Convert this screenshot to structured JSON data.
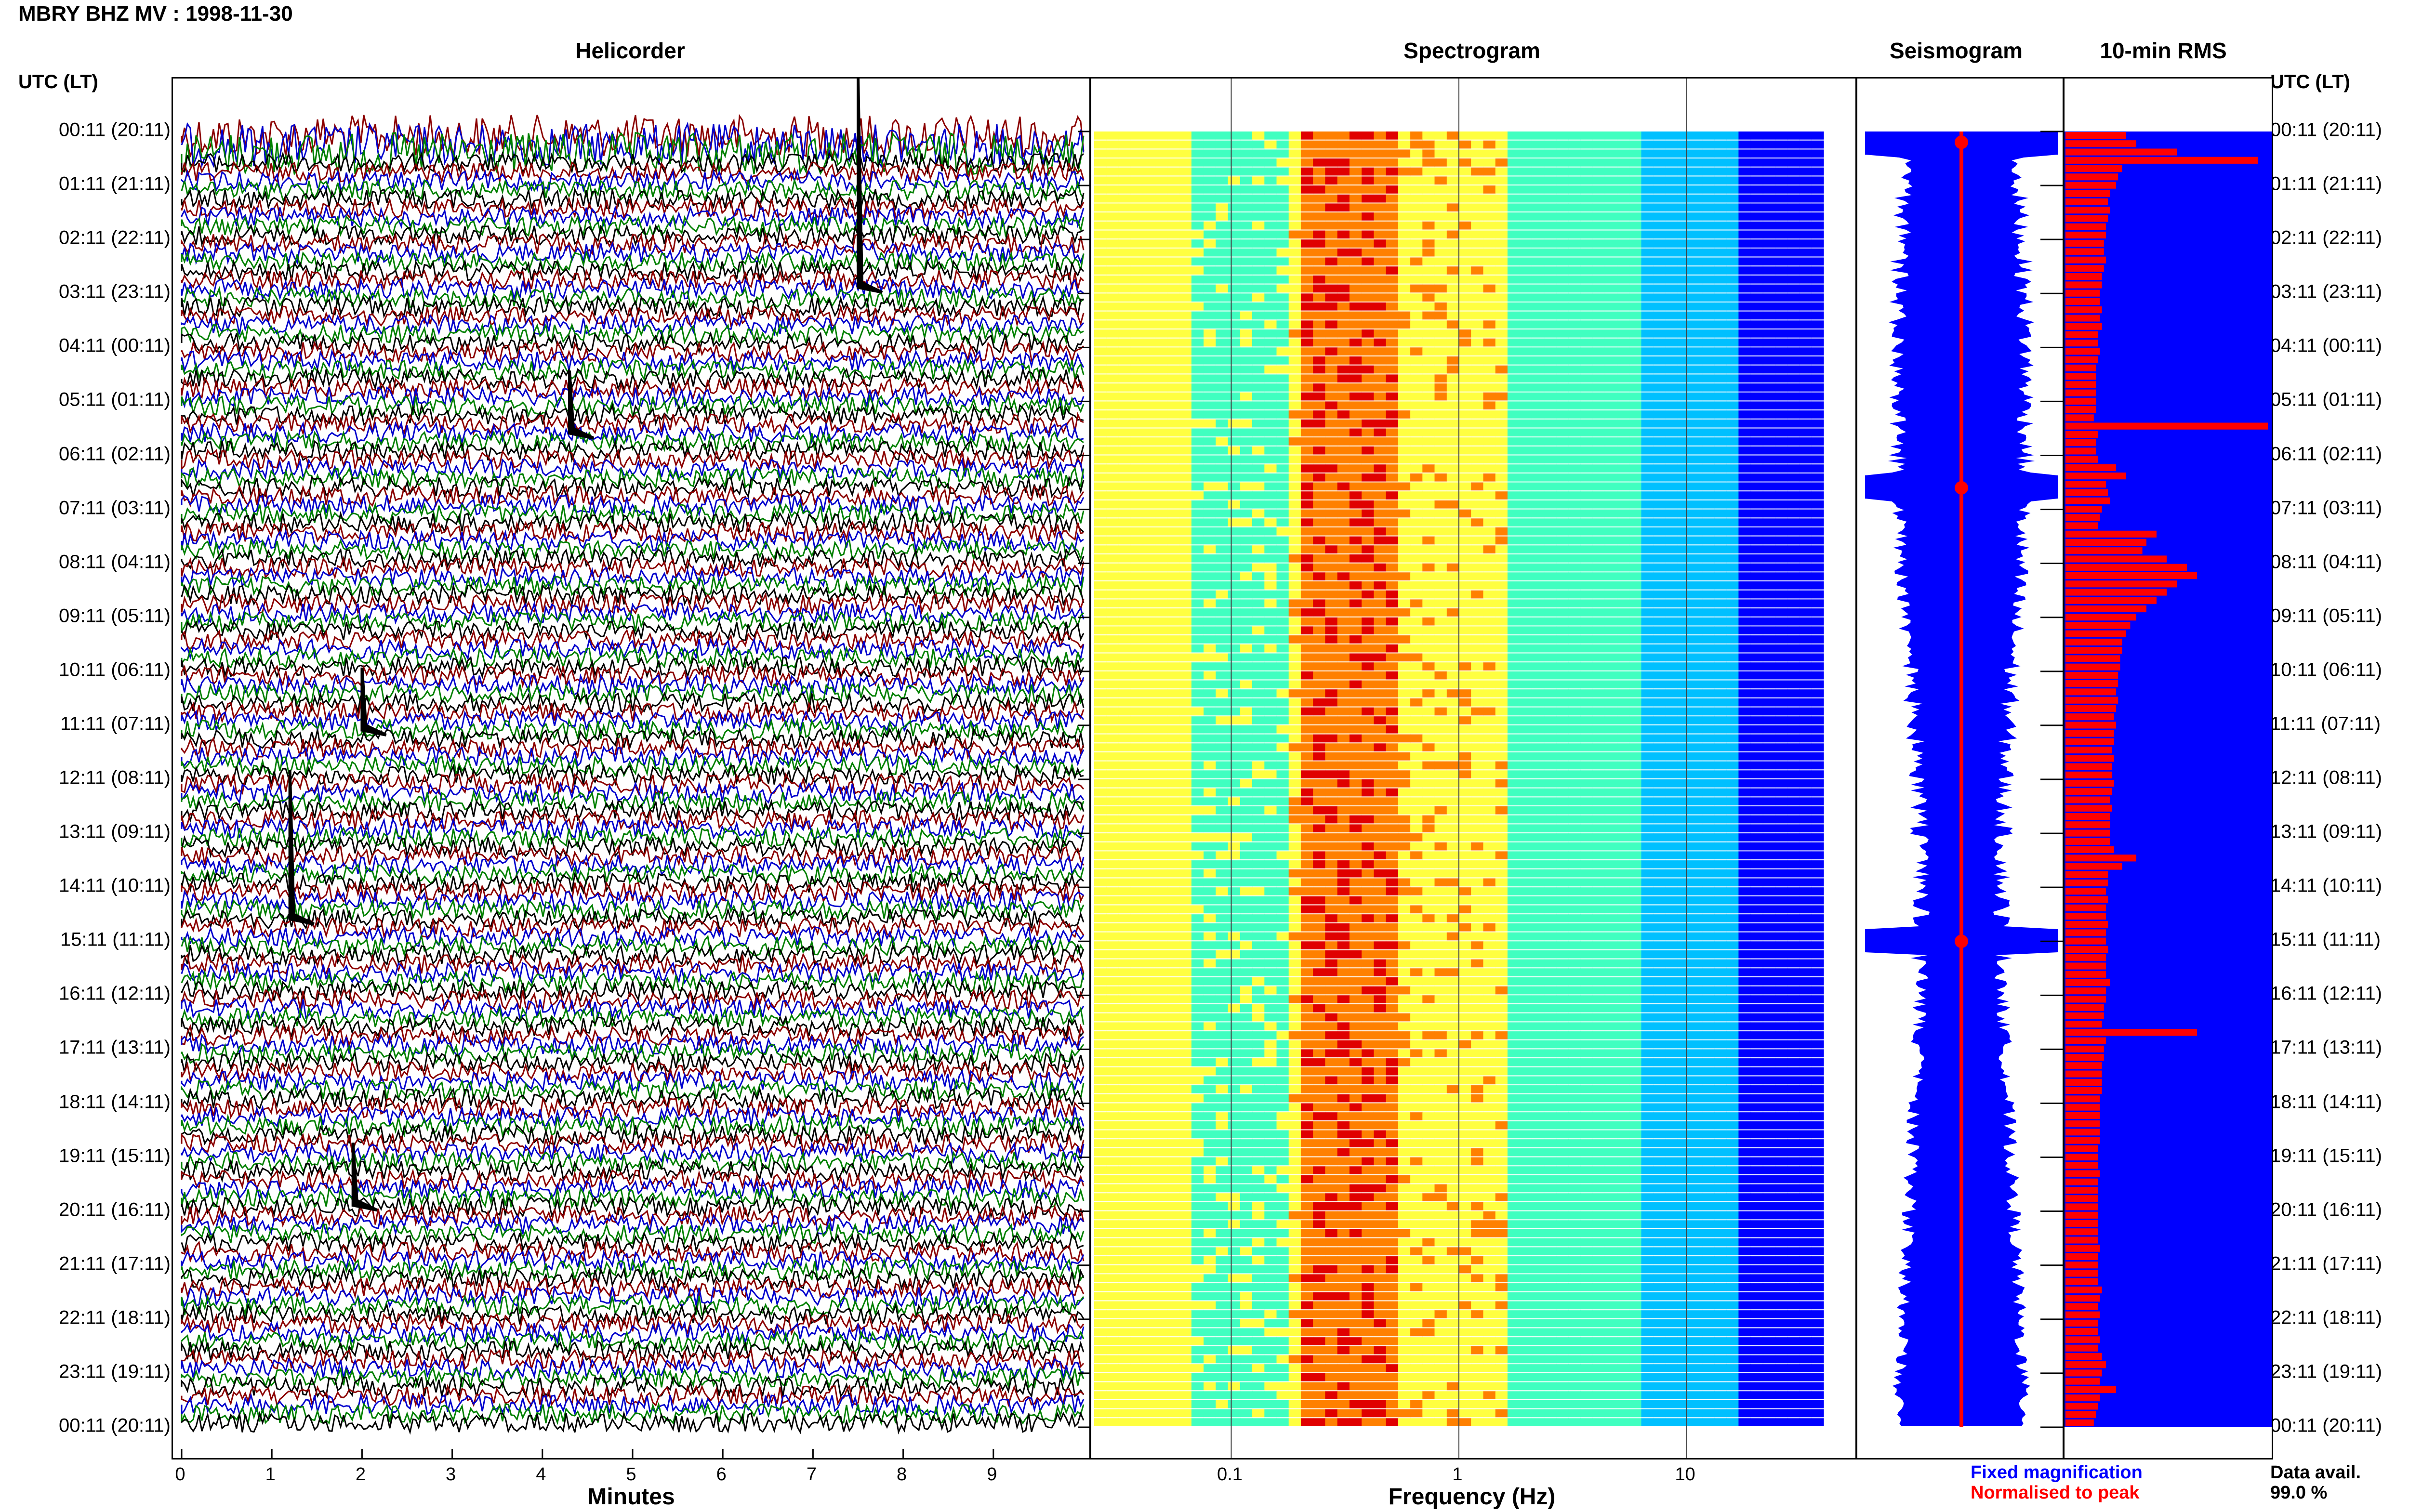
{
  "header": {
    "title": "MBRY BHZ MV : 1998-11-30"
  },
  "panels": {
    "helicorder": "Helicorder",
    "spectrogram": "Spectrogram",
    "seismogram": "Seismogram",
    "rms": "10-min RMS"
  },
  "utc_header": "UTC (LT)",
  "time_labels": [
    "00:11 (20:11)",
    "01:11 (21:11)",
    "02:11 (22:11)",
    "03:11 (23:11)",
    "04:11 (00:11)",
    "05:11 (01:11)",
    "06:11 (02:11)",
    "07:11 (03:11)",
    "08:11 (04:11)",
    "09:11 (05:11)",
    "10:11 (06:11)",
    "11:11 (07:11)",
    "12:11 (08:11)",
    "13:11 (09:11)",
    "14:11 (10:11)",
    "15:11 (11:11)",
    "16:11 (12:11)",
    "17:11 (13:11)",
    "18:11 (14:11)",
    "19:11 (15:11)",
    "20:11 (16:11)",
    "21:11 (17:11)",
    "22:11 (18:11)",
    "23:11 (19:11)",
    "00:11 (20:11)"
  ],
  "axes": {
    "minutes_label": "Minutes",
    "minutes_ticks": [
      "0",
      "1",
      "2",
      "3",
      "4",
      "5",
      "6",
      "7",
      "8",
      "9"
    ],
    "frequency_label": "Frequency (Hz)",
    "frequency_ticks": [
      "0.1",
      "1",
      "10"
    ]
  },
  "legend": {
    "fixed": "Fixed magnification",
    "normalised": "Normalised to peak",
    "fixed_color": "#0000ff",
    "normalised_color": "#ff0000"
  },
  "data_avail": {
    "label": "Data avail.",
    "value": "99.0 %"
  },
  "chart_data": [
    {
      "type": "line",
      "panel": "Helicorder",
      "xlabel": "Minutes",
      "xlim": [
        0,
        10
      ],
      "rows": 144,
      "trace_colors": [
        "#8b0000",
        "#0000cd",
        "#008000",
        "#000000"
      ],
      "events": [
        {
          "row_hour": 2.8,
          "minute": 7.5,
          "amplitude": "very large"
        },
        {
          "row_hour": 14.5,
          "minute": 1.2,
          "amplitude": "large"
        },
        {
          "row_hour": 5.5,
          "minute": 4.3,
          "amplitude": "medium"
        },
        {
          "row_hour": 19.8,
          "minute": 1.9,
          "amplitude": "medium"
        },
        {
          "row_hour": 11.0,
          "minute": 2.0,
          "amplitude": "medium"
        }
      ]
    },
    {
      "type": "heatmap",
      "panel": "Spectrogram",
      "xlabel": "Frequency (Hz)",
      "xscale": "log",
      "xlim": [
        0.025,
        40
      ],
      "peak_band_hz": [
        0.2,
        0.5
      ],
      "colormap": [
        "#00008b",
        "#0000ff",
        "#00c0ff",
        "#40ffc0",
        "#ffff40",
        "#ff8000",
        "#e00000"
      ]
    },
    {
      "type": "line",
      "panel": "Seismogram",
      "series": [
        {
          "name": "Fixed magnification",
          "color": "#0000ff"
        },
        {
          "name": "Normalised to peak",
          "color": "#ff0000"
        }
      ],
      "spikes_hours": [
        0.2,
        6.6,
        15.0
      ]
    },
    {
      "type": "bar",
      "panel": "10-min RMS",
      "orientation": "horizontal",
      "background": "#0000ff",
      "bar_color": "#ff0000",
      "values": [
        0.3,
        0.35,
        0.55,
        0.95,
        0.28,
        0.26,
        0.25,
        0.22,
        0.21,
        0.22,
        0.21,
        0.2,
        0.2,
        0.19,
        0.19,
        0.2,
        0.19,
        0.18,
        0.18,
        0.17,
        0.17,
        0.18,
        0.17,
        0.18,
        0.16,
        0.16,
        0.17,
        0.16,
        0.15,
        0.15,
        0.15,
        0.15,
        0.15,
        0.15,
        0.14,
        1.0,
        0.16,
        0.15,
        0.15,
        0.16,
        0.25,
        0.3,
        0.2,
        0.21,
        0.22,
        0.18,
        0.17,
        0.16,
        0.45,
        0.4,
        0.38,
        0.5,
        0.6,
        0.65,
        0.55,
        0.5,
        0.45,
        0.4,
        0.35,
        0.32,
        0.3,
        0.28,
        0.28,
        0.27,
        0.27,
        0.26,
        0.26,
        0.25,
        0.26,
        0.25,
        0.24,
        0.25,
        0.24,
        0.24,
        0.23,
        0.24,
        0.23,
        0.23,
        0.24,
        0.23,
        0.22,
        0.23,
        0.22,
        0.22,
        0.22,
        0.22,
        0.24,
        0.35,
        0.28,
        0.21,
        0.21,
        0.2,
        0.21,
        0.2,
        0.2,
        0.21,
        0.2,
        0.2,
        0.21,
        0.2,
        0.2,
        0.2,
        0.22,
        0.2,
        0.2,
        0.19,
        0.19,
        0.18,
        0.65,
        0.2,
        0.19,
        0.19,
        0.18,
        0.18,
        0.18,
        0.18,
        0.17,
        0.17,
        0.17,
        0.17,
        0.17,
        0.17,
        0.16,
        0.16,
        0.16,
        0.17,
        0.16,
        0.16,
        0.16,
        0.16,
        0.16,
        0.16,
        0.16,
        0.16,
        0.17,
        0.16,
        0.16,
        0.16,
        0.16,
        0.18,
        0.17,
        0.16,
        0.17,
        0.16,
        0.16,
        0.17,
        0.16,
        0.18,
        0.2,
        0.18,
        0.17,
        0.25,
        0.17,
        0.16,
        0.15,
        0.14
      ]
    }
  ]
}
